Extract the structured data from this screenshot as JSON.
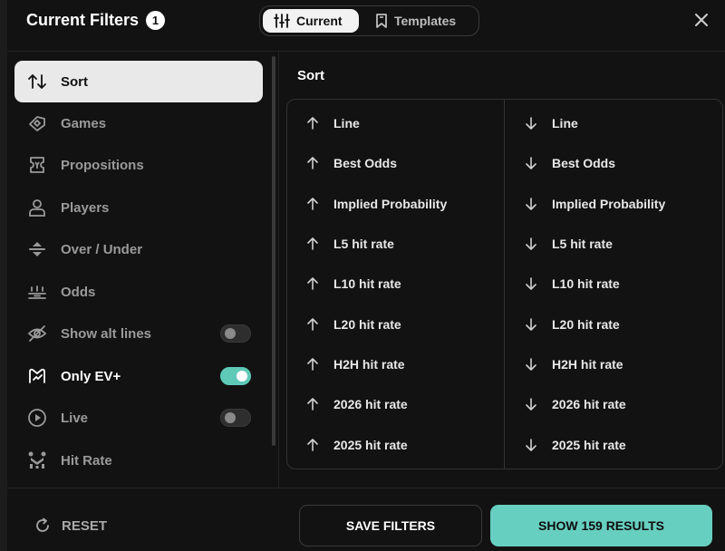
{
  "header": {
    "title": "Current Filters",
    "badge_count": "1",
    "tabs": [
      {
        "label": "Current",
        "icon": "sliders-icon",
        "active": true
      },
      {
        "label": "Templates",
        "icon": "bookmark-icon",
        "active": false
      }
    ]
  },
  "sidebar": {
    "items": [
      {
        "label": "Sort",
        "icon": "sort-arrows-icon",
        "active": true
      },
      {
        "label": "Games",
        "icon": "games-icon"
      },
      {
        "label": "Propositions",
        "icon": "ticket-icon"
      },
      {
        "label": "Players",
        "icon": "user-icon"
      },
      {
        "label": "Over / Under",
        "icon": "over-under-icon"
      },
      {
        "label": "Odds",
        "icon": "odds-icon"
      },
      {
        "label": "Show alt lines",
        "icon": "eye-off-icon",
        "toggle": false
      },
      {
        "label": "Only EV+",
        "icon": "ev-icon",
        "toggle": true
      },
      {
        "label": "Live",
        "icon": "play-circle-icon",
        "toggle": false
      },
      {
        "label": "Hit Rate",
        "icon": "hit-rate-icon"
      }
    ]
  },
  "content": {
    "section_title": "Sort",
    "ascending": [
      "Line",
      "Best Odds",
      "Implied Probability",
      "L5 hit rate",
      "L10 hit rate",
      "L20 hit rate",
      "H2H hit rate",
      "2026 hit rate",
      "2025 hit rate"
    ],
    "descending": [
      "Line",
      "Best Odds",
      "Implied Probability",
      "L5 hit rate",
      "L10 hit rate",
      "L20 hit rate",
      "H2H hit rate",
      "2026 hit rate",
      "2025 hit rate"
    ]
  },
  "footer": {
    "reset_label": "RESET",
    "save_label": "SAVE FILTERS",
    "show_label": "SHOW 159 RESULTS"
  },
  "colors": {
    "background": "#121212",
    "accent": "#67cfc0",
    "active_item": "#e9e9e9"
  }
}
